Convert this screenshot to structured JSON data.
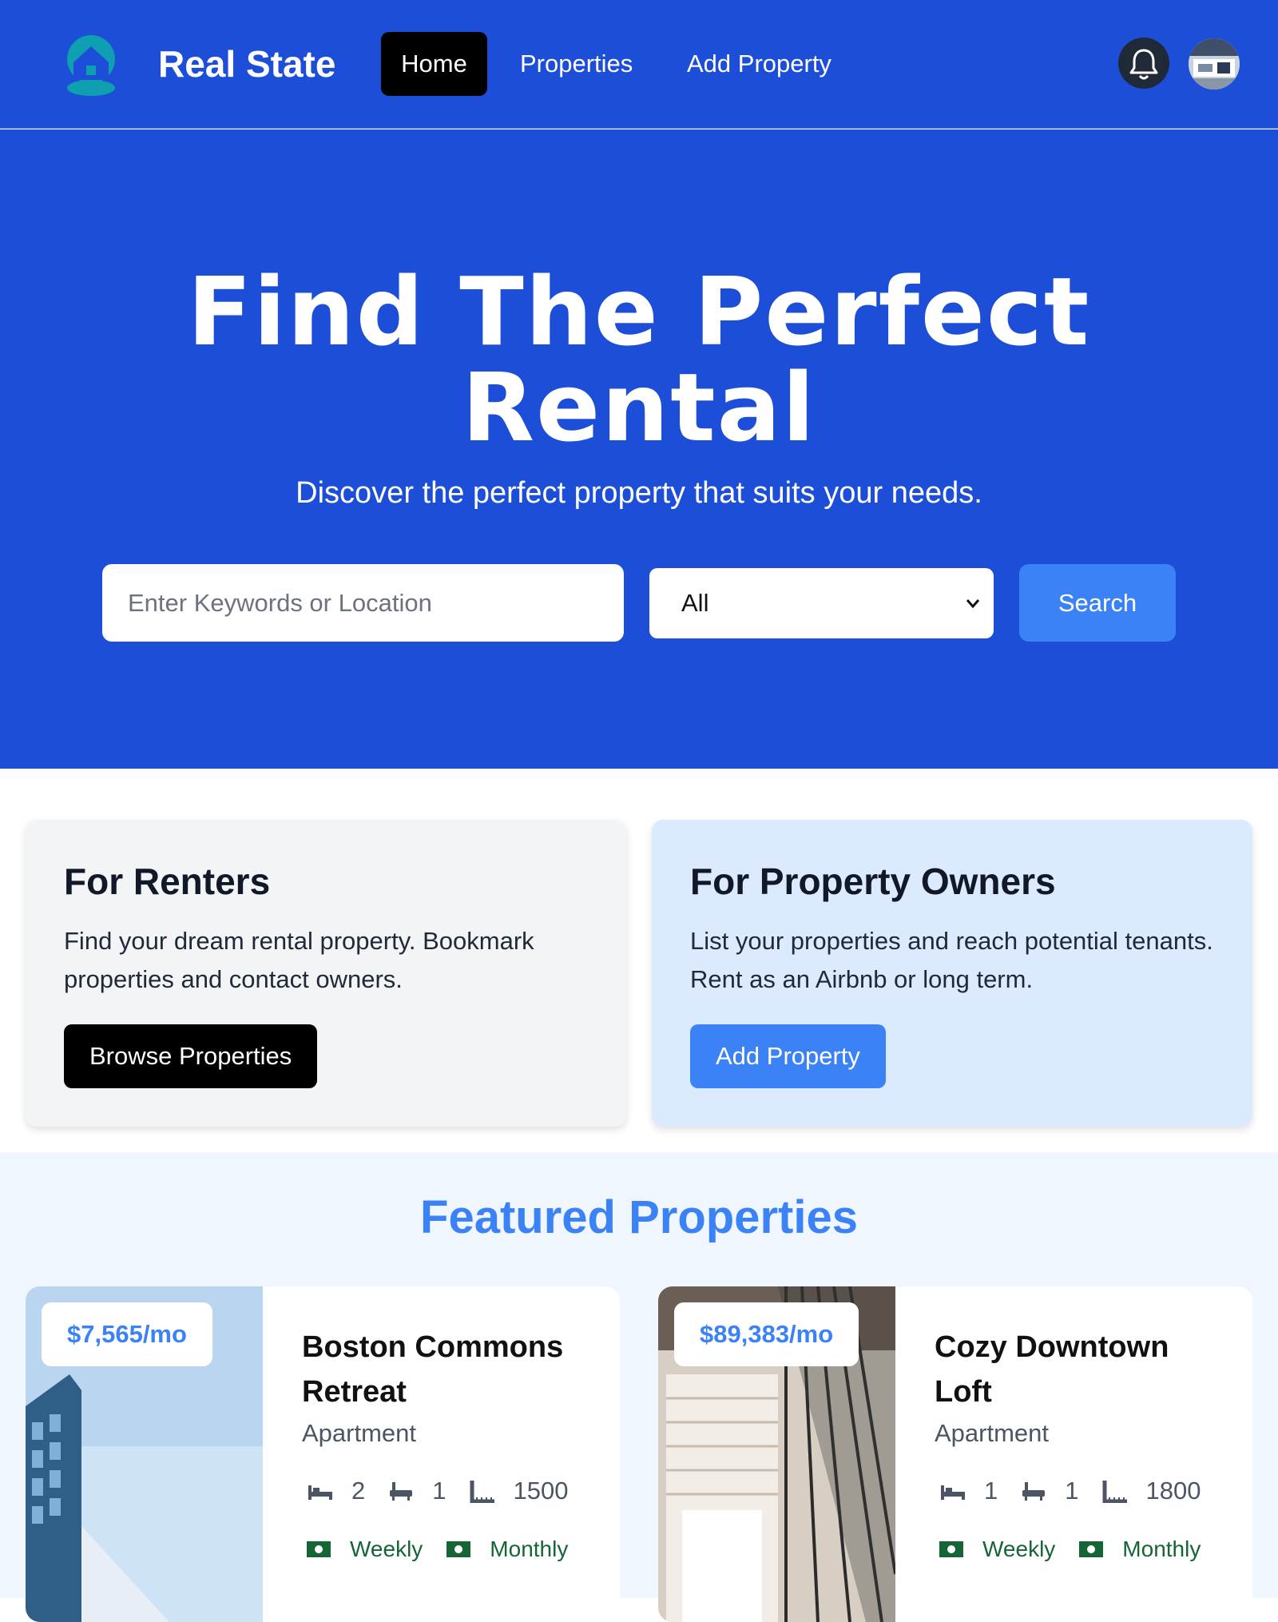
{
  "nav": {
    "brand": "Real State",
    "links": [
      "Home",
      "Properties",
      "Add Property"
    ],
    "icons": {
      "logo": "house-logo-icon",
      "bell": "bell-icon",
      "avatar": "user-avatar"
    }
  },
  "hero": {
    "title_line1": "Find The Perfect",
    "title_line2": "Rental",
    "subtitle": "Discover the perfect property that suits your needs.",
    "search_placeholder": "Enter Keywords or Location",
    "type_selected": "All",
    "search_label": "Search"
  },
  "renters": {
    "title": "For Renters",
    "text": "Find your dream rental property. Bookmark properties and contact owners.",
    "button": "Browse Properties"
  },
  "owners": {
    "title": "For Property Owners",
    "text": "List your properties and reach potential tenants. Rent as an Airbnb or long term.",
    "button": "Add Property"
  },
  "featured": {
    "title": "Featured Properties",
    "properties": [
      {
        "price": "$7,565/mo",
        "name": "Boston Commons Retreat",
        "type": "Apartment",
        "beds": "2",
        "baths": "1",
        "sqft": "1500",
        "rates": [
          "Weekly",
          "Monthly"
        ]
      },
      {
        "price": "$89,383/mo",
        "name": "Cozy Downtown Loft",
        "type": "Apartment",
        "beds": "1",
        "baths": "1",
        "sqft": "1800",
        "rates": [
          "Weekly",
          "Monthly"
        ]
      }
    ]
  },
  "colors": {
    "primary_blue": "#1d4ed8",
    "accent_blue": "#3b82f6",
    "rate_green": "#166534"
  }
}
